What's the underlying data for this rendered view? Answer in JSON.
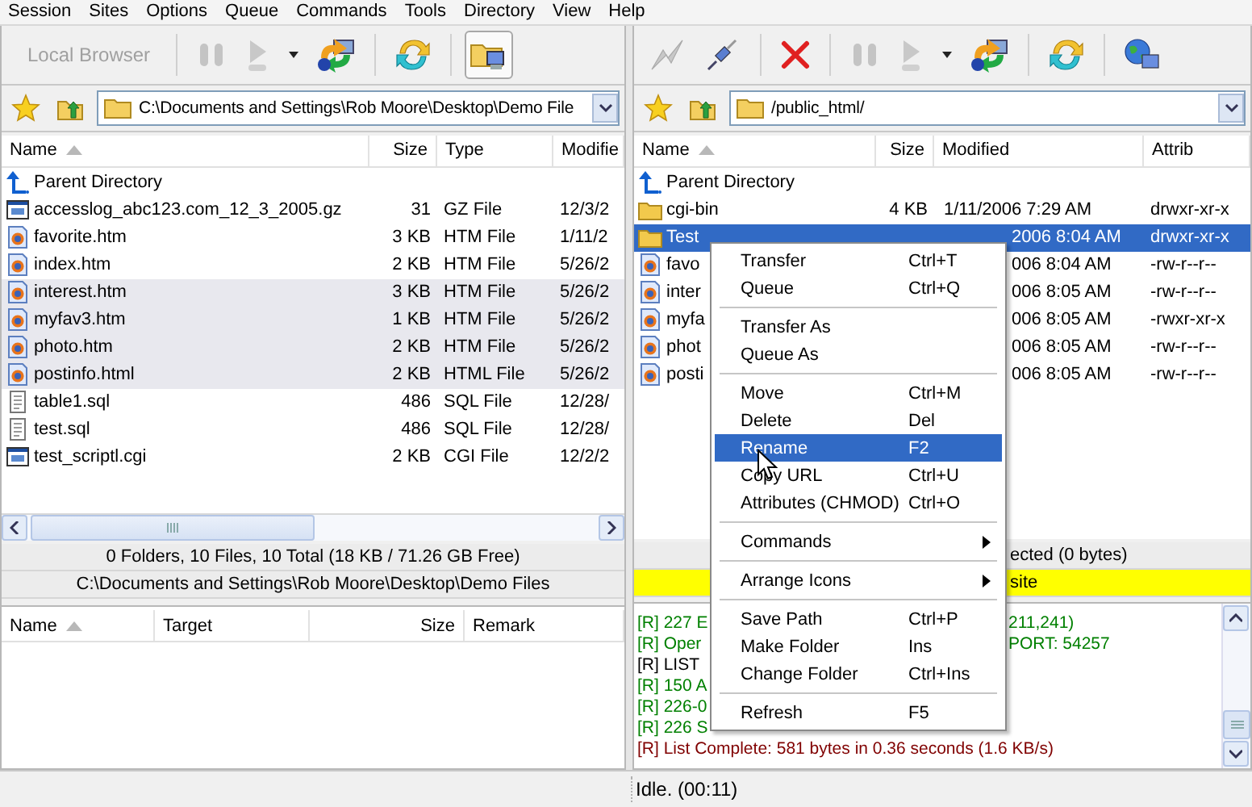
{
  "menu_bar": [
    "Session",
    "Sites",
    "Options",
    "Queue",
    "Commands",
    "Tools",
    "Directory",
    "View",
    "Help"
  ],
  "local": {
    "toolbar_label": "Local Browser",
    "address": "C:\\Documents and Settings\\Rob Moore\\Desktop\\Demo File",
    "columns": [
      "Name",
      "Size",
      "Type",
      "Modifie"
    ],
    "rows": [
      {
        "kind": "parent",
        "name": "Parent Directory",
        "selected": false
      },
      {
        "kind": "app",
        "name": "accesslog_abc123.com_12_3_2005.gz",
        "size": "31",
        "type": "GZ File",
        "modified": "12/3/2",
        "selected": false
      },
      {
        "kind": "web",
        "name": "favorite.htm",
        "size": "3 KB",
        "type": "HTM File",
        "modified": "1/11/2",
        "selected": false
      },
      {
        "kind": "web",
        "name": "index.htm",
        "size": "2 KB",
        "type": "HTM File",
        "modified": "5/26/2",
        "selected": false
      },
      {
        "kind": "web",
        "name": "interest.htm",
        "size": "3 KB",
        "type": "HTM File",
        "modified": "5/26/2",
        "selected": true
      },
      {
        "kind": "web",
        "name": "myfav3.htm",
        "size": "1 KB",
        "type": "HTM File",
        "modified": "5/26/2",
        "selected": true
      },
      {
        "kind": "web",
        "name": "photo.htm",
        "size": "2 KB",
        "type": "HTM File",
        "modified": "5/26/2",
        "selected": true
      },
      {
        "kind": "web",
        "name": "postinfo.html",
        "size": "2 KB",
        "type": "HTML File",
        "modified": "5/26/2",
        "selected": true
      },
      {
        "kind": "text",
        "name": "table1.sql",
        "size": "486",
        "type": "SQL File",
        "modified": "12/28/",
        "selected": false
      },
      {
        "kind": "text",
        "name": "test.sql",
        "size": "486",
        "type": "SQL File",
        "modified": "12/28/",
        "selected": false
      },
      {
        "kind": "app",
        "name": "test_scriptl.cgi",
        "size": "2 KB",
        "type": "CGI File",
        "modified": "12/2/2",
        "selected": false
      }
    ],
    "summary": "0 Folders, 10 Files, 10 Total (18 KB / 71.26 GB Free)",
    "path": "C:\\Documents and Settings\\Rob Moore\\Desktop\\Demo Files"
  },
  "queue": {
    "columns": [
      "Name",
      "Target",
      "Size",
      "Remark"
    ]
  },
  "remote": {
    "address": "/public_html/",
    "columns": [
      "Name",
      "Size",
      "Modified",
      "Attrib"
    ],
    "rows": [
      {
        "kind": "parent",
        "name": "Parent Directory",
        "selected": false
      },
      {
        "kind": "folder",
        "name": "cgi-bin",
        "size": "4 KB",
        "modified": "1/11/2006 7:29 AM",
        "attrib": "drwxr-xr-x",
        "selected": false
      },
      {
        "kind": "folder",
        "name": "Test",
        "modified": "2006 8:04 AM",
        "attrib": "drwxr-xr-x",
        "selected": true
      },
      {
        "kind": "web",
        "name": "favo",
        "modified": "006 8:04 AM",
        "attrib": "-rw-r--r--",
        "selected": false
      },
      {
        "kind": "web",
        "name": "inter",
        "modified": "006 8:05 AM",
        "attrib": "-rw-r--r--",
        "selected": false
      },
      {
        "kind": "web",
        "name": "myfa",
        "modified": "006 8:05 AM",
        "attrib": "-rwxr-xr-x",
        "selected": false
      },
      {
        "kind": "web",
        "name": "phot",
        "modified": "006 8:05 AM",
        "attrib": "-rw-r--r--",
        "selected": false
      },
      {
        "kind": "web",
        "name": "posti",
        "modified": "006 8:05 AM",
        "attrib": "-rw-r--r--",
        "selected": false
      }
    ],
    "selection_status": "ected (0 bytes)",
    "banner": "site",
    "log": [
      {
        "text": "[R] 227 E",
        "tail": "211,241)",
        "color": "#008000"
      },
      {
        "text": "[R] Oper",
        "tail": "PORT: 54257",
        "color": "#008000"
      },
      {
        "text": "[R] LIST",
        "color": "#000000"
      },
      {
        "text": "[R] 150 A",
        "color": "#008000"
      },
      {
        "text": "[R] 226-0",
        "color": "#008000"
      },
      {
        "text": "[R] 226 S",
        "color": "#008000"
      },
      {
        "text": "[R] List Complete: 581 bytes in 0.36 seconds (1.6 KB/s)",
        "color": "#800000"
      }
    ]
  },
  "context_menu": [
    {
      "kind": "item",
      "label": "Transfer",
      "shortcut": "Ctrl+T",
      "selected": false
    },
    {
      "kind": "item",
      "label": "Queue",
      "shortcut": "Ctrl+Q",
      "selected": false
    },
    {
      "kind": "separator"
    },
    {
      "kind": "item",
      "label": "Transfer As",
      "selected": false
    },
    {
      "kind": "item",
      "label": "Queue As",
      "selected": false
    },
    {
      "kind": "separator"
    },
    {
      "kind": "item",
      "label": "Move",
      "shortcut": "Ctrl+M",
      "selected": false
    },
    {
      "kind": "item",
      "label": "Delete",
      "shortcut": "Del",
      "selected": false
    },
    {
      "kind": "item",
      "label": "Rename",
      "shortcut": "F2",
      "selected": true
    },
    {
      "kind": "item",
      "label": "Copy URL",
      "shortcut": "Ctrl+U",
      "selected": false
    },
    {
      "kind": "item",
      "label": "Attributes (CHMOD)",
      "shortcut": "Ctrl+O",
      "selected": false
    },
    {
      "kind": "separator"
    },
    {
      "kind": "submenu",
      "label": "Commands",
      "selected": false
    },
    {
      "kind": "separator"
    },
    {
      "kind": "submenu",
      "label": "Arrange Icons",
      "selected": false
    },
    {
      "kind": "separator"
    },
    {
      "kind": "item",
      "label": "Save Path",
      "shortcut": "Ctrl+P",
      "selected": false
    },
    {
      "kind": "item",
      "label": "Make Folder",
      "shortcut": "Ins",
      "selected": false
    },
    {
      "kind": "item",
      "label": "Change Folder",
      "shortcut": "Ctrl+Ins",
      "selected": false
    },
    {
      "kind": "separator"
    },
    {
      "kind": "item",
      "label": "Refresh",
      "shortcut": "F5",
      "selected": false
    }
  ],
  "status": "Idle. (00:11)"
}
